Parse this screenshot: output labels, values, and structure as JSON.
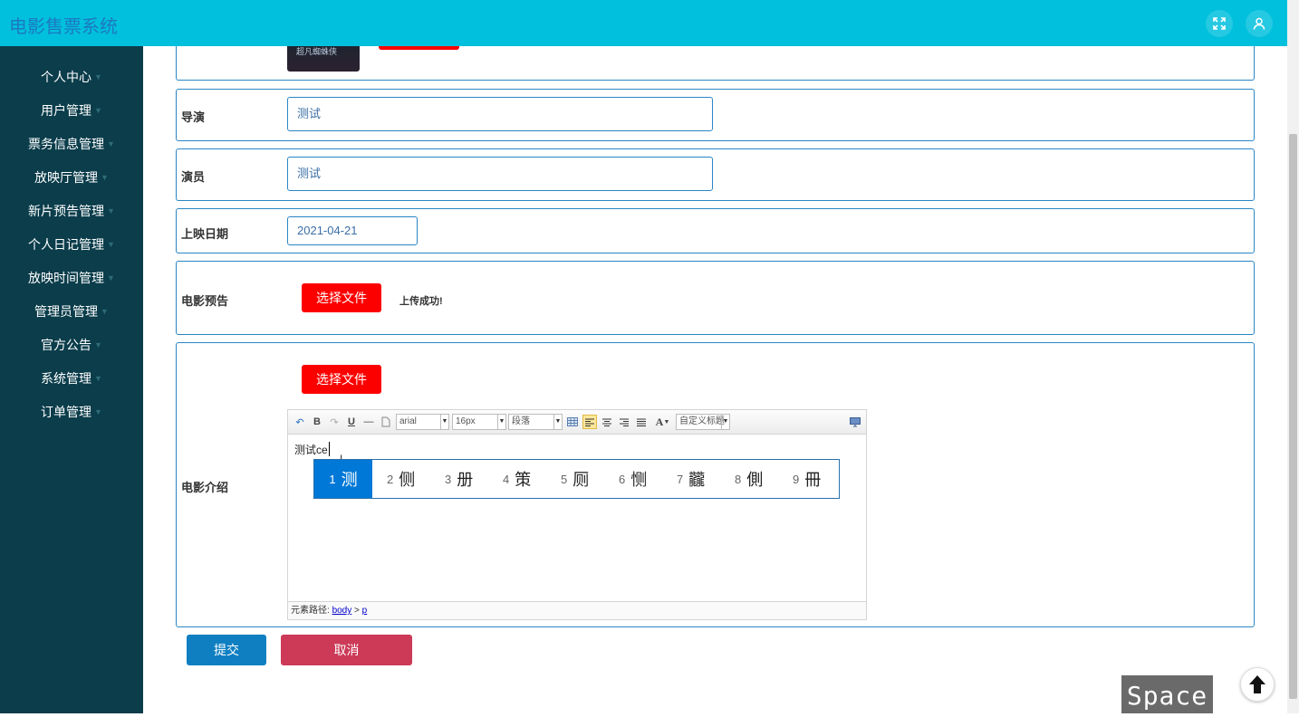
{
  "app": {
    "title": "电影售票系统"
  },
  "header_icons": [
    "fullscreen-icon",
    "user-icon"
  ],
  "sidebar": {
    "items": [
      {
        "label": "个人中心"
      },
      {
        "label": "用户管理"
      },
      {
        "label": "票务信息管理"
      },
      {
        "label": "放映厅管理"
      },
      {
        "label": "新片预告管理"
      },
      {
        "label": "个人日记管理"
      },
      {
        "label": "放映时间管理"
      },
      {
        "label": "管理员管理"
      },
      {
        "label": "官方公告"
      },
      {
        "label": "系统管理"
      },
      {
        "label": "订单管理"
      }
    ]
  },
  "form": {
    "poster": {
      "caption": "超凡蜘蛛侠"
    },
    "director": {
      "label": "导演",
      "value": "测试"
    },
    "actors": {
      "label": "演员",
      "value": "测试"
    },
    "release_date": {
      "label": "上映日期",
      "value": "2021-04-21"
    },
    "trailer": {
      "label": "电影预告",
      "button": "选择文件",
      "status": "上传成功!"
    },
    "intro": {
      "label": "电影介绍",
      "button": "选择文件",
      "editor": {
        "font": "arial",
        "size": "16px",
        "paragraph": "段落",
        "custom_title": "自定义标题",
        "content": "测试ce",
        "path_label": "元素路径:",
        "path_body": "body",
        "path_sep": ">",
        "path_p": "p"
      },
      "ime_candidates": [
        {
          "num": "1",
          "char": "测"
        },
        {
          "num": "2",
          "char": "侧"
        },
        {
          "num": "3",
          "char": "册"
        },
        {
          "num": "4",
          "char": "策"
        },
        {
          "num": "5",
          "char": "厕"
        },
        {
          "num": "6",
          "char": "恻"
        },
        {
          "num": "7",
          "char": "龖"
        },
        {
          "num": "8",
          "char": "側"
        },
        {
          "num": "9",
          "char": "冊"
        }
      ]
    },
    "submit": "提交",
    "cancel": "取消"
  },
  "overlay": {
    "key_hint": "Space"
  },
  "colors": {
    "header": "#00c0dd",
    "sidebar": "#0b3d4b",
    "border": "#2a86c4",
    "upload": "#fc0000",
    "submit": "#0f7fc2",
    "cancel": "#cc3a58"
  }
}
